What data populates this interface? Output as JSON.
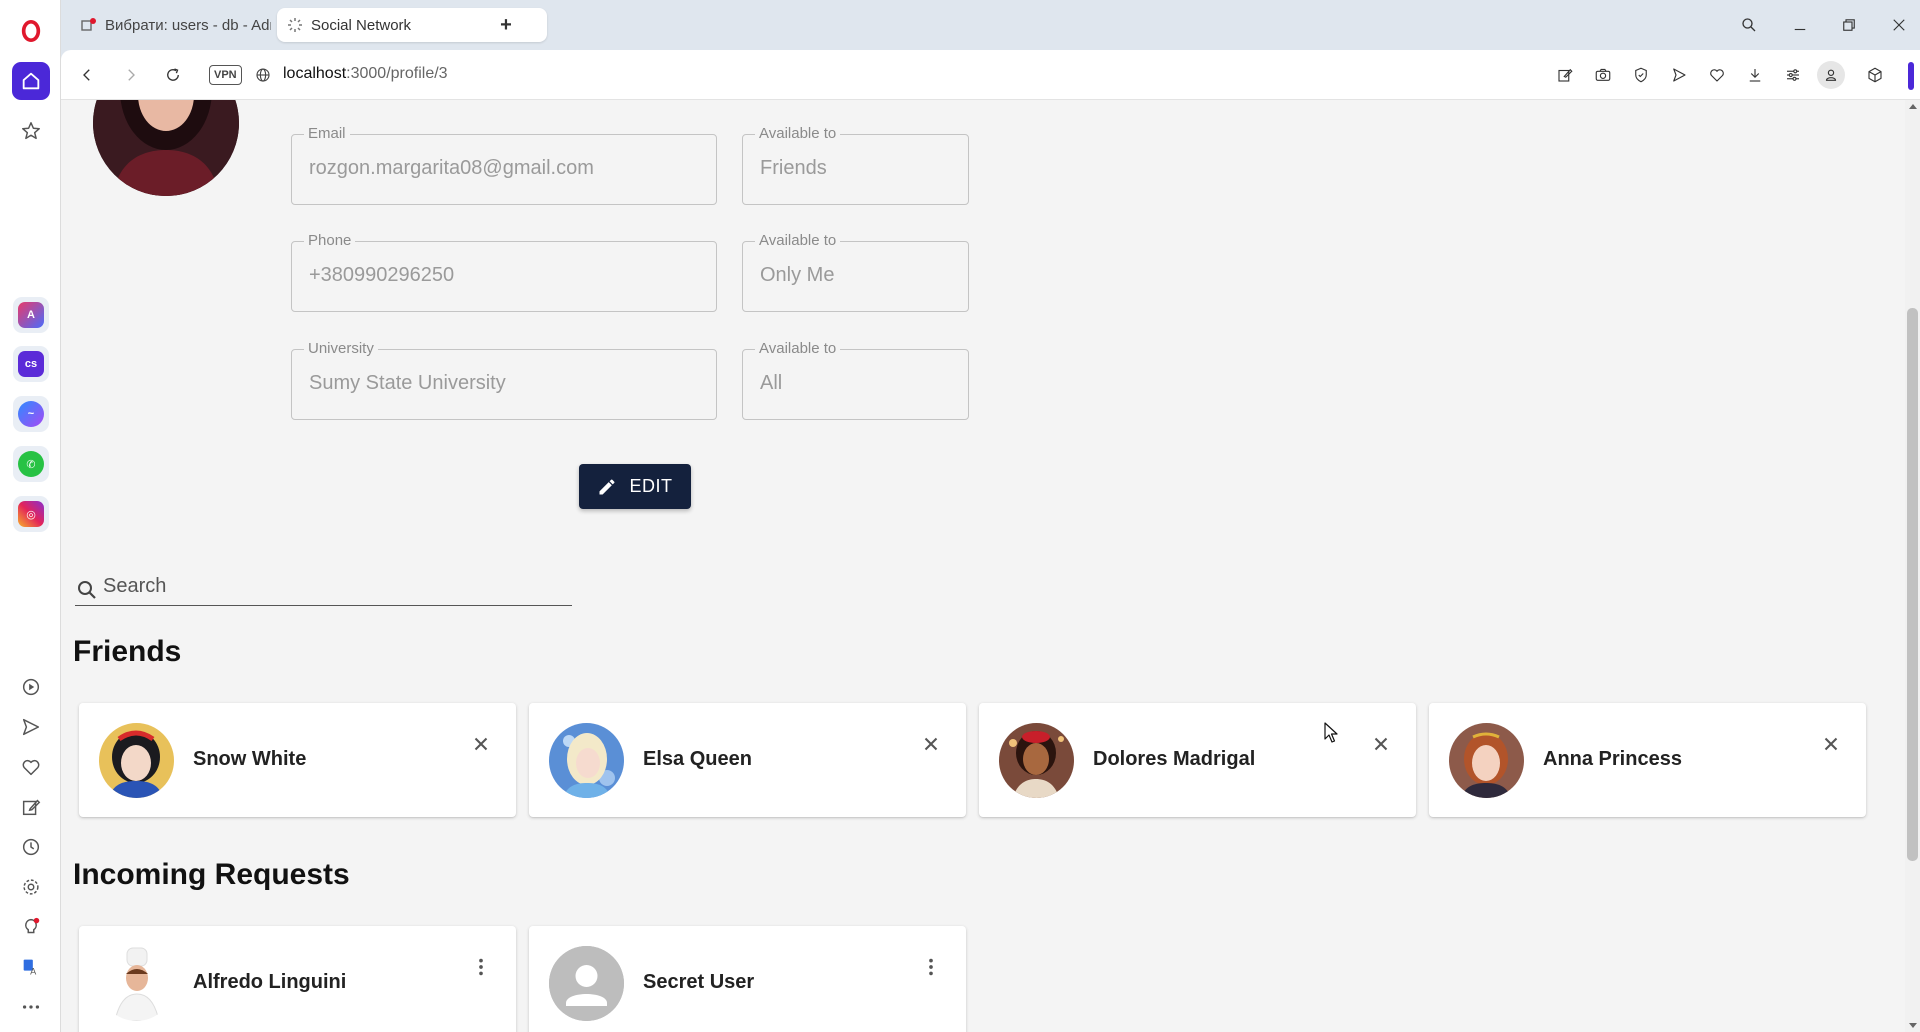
{
  "browser": {
    "tabs": [
      {
        "label": "Вибрати: users - db - Adminer",
        "active": false
      },
      {
        "label": "Social Network",
        "active": true
      }
    ],
    "new_tab_label": "+",
    "address": {
      "vpn_label": "VPN",
      "host": "localhost",
      "path": ":3000/profile/3"
    },
    "accent_color": "#4b28d8"
  },
  "sidebar": {
    "icons": [
      "opera-logo-icon",
      "home-icon",
      "star-icon",
      "aria-icon",
      "chatgpt-icon",
      "messenger-icon",
      "whatsapp-icon",
      "instagram-icon",
      "player-icon",
      "send-icon",
      "heart-icon",
      "edit-icon",
      "history-icon",
      "settings-icon",
      "lightbulb-icon",
      "translate-icon",
      "more-icon"
    ]
  },
  "profile": {
    "fields": [
      {
        "label": "Email",
        "value": "rozgon.margarita08@gmail.com",
        "visibility_label": "Available to",
        "visibility": "Friends"
      },
      {
        "label": "Phone",
        "value": "+380990296250",
        "visibility_label": "Available to",
        "visibility": "Only Me"
      },
      {
        "label": "University",
        "value": "Sumy State University",
        "visibility_label": "Available to",
        "visibility": "All"
      }
    ],
    "edit_button": "EDIT",
    "button_color": "#14213d"
  },
  "search": {
    "placeholder": "Search"
  },
  "friends": {
    "title": "Friends",
    "items": [
      {
        "name": "Snow White"
      },
      {
        "name": "Elsa Queen"
      },
      {
        "name": "Dolores Madrigal"
      },
      {
        "name": "Anna Princess"
      }
    ]
  },
  "incoming": {
    "title": "Incoming Requests",
    "items": [
      {
        "name": "Alfredo Linguini"
      },
      {
        "name": "Secret User"
      }
    ]
  }
}
